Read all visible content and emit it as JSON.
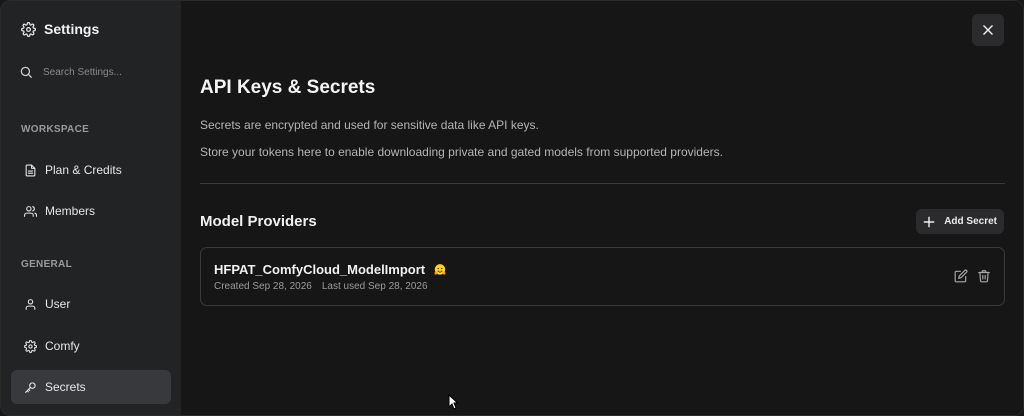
{
  "sidebar": {
    "title": "Settings",
    "search_placeholder": "Search Settings...",
    "sections": [
      {
        "label": "WORKSPACE"
      },
      {
        "label": "GENERAL"
      }
    ],
    "items": [
      {
        "label": "Plan & Credits",
        "icon": "document-icon"
      },
      {
        "label": "Members",
        "icon": "users-icon"
      },
      {
        "label": "User",
        "icon": "user-icon"
      },
      {
        "label": "Comfy",
        "icon": "gear-icon"
      },
      {
        "label": "Secrets",
        "icon": "key-icon",
        "active": true
      }
    ]
  },
  "main": {
    "title": "API Keys & Secrets",
    "descriptions": [
      "Secrets are encrypted and used for sensitive data like API keys.",
      "Store your tokens here to enable downloading private and gated models from supported providers."
    ],
    "section_title": "Model Providers",
    "add_button_label": "Add Secret",
    "secrets": [
      {
        "name": "HFPAT_ComfyCloud_ModelImport",
        "provider_icon": "hugging-face-icon",
        "created": "Created Sep 28, 2026",
        "last_used": "Last used Sep 28, 2026"
      }
    ]
  },
  "colors": {
    "background": "#161616",
    "sidebar": "#222325",
    "active_item": "#38393c",
    "button": "#2b2b2d",
    "hf_yellow": "#FFD21E"
  }
}
